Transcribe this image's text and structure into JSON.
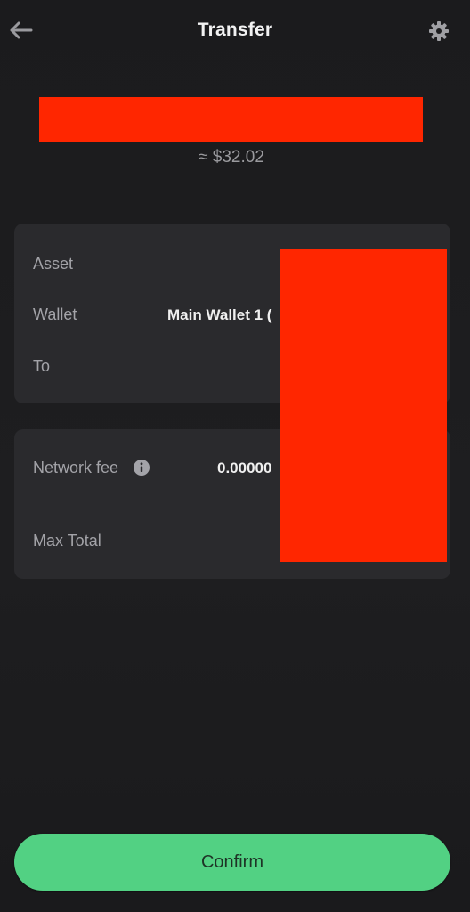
{
  "header": {
    "title": "Transfer",
    "back_icon": "arrow-left-icon",
    "settings_icon": "gear-icon"
  },
  "amount": {
    "fiat_value": "≈ $32.02"
  },
  "details": {
    "asset_label": "Asset",
    "wallet_label": "Wallet",
    "wallet_value": "Main Wallet 1 (",
    "to_label": "To"
  },
  "fees": {
    "network_fee_label": "Network fee",
    "network_fee_value": "0.00000",
    "info_icon": "info-icon",
    "max_total_label": "Max Total"
  },
  "actions": {
    "confirm_label": "Confirm"
  },
  "colors": {
    "background": "#1c1c1e",
    "card": "#2a2a2d",
    "accent_green": "#52d183",
    "redaction": "#ff2600"
  }
}
